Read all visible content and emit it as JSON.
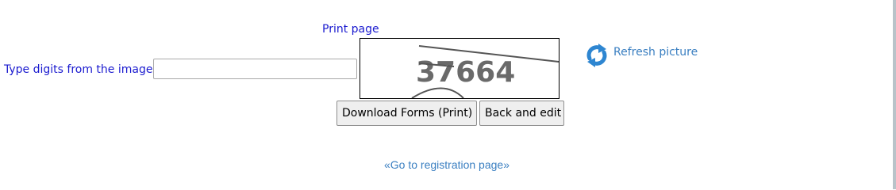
{
  "print_link": "Print page",
  "captcha": {
    "label": "Type digits from the image",
    "input_value": "",
    "image_digits": "37664",
    "refresh_label": "Refresh picture"
  },
  "buttons": {
    "download": "Download Forms (Print)",
    "back": "Back and edit"
  },
  "registration_link": "«Go to registration page»",
  "colors": {
    "label_blue": "#1a1acf",
    "link_blue": "#3a7fc1",
    "icon_blue": "#2e86d1"
  },
  "icons": {
    "refresh": "refresh-icon"
  }
}
